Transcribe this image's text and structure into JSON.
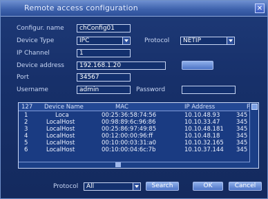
{
  "window": {
    "title": "Remote access configuration",
    "close_glyph": "✕"
  },
  "form": {
    "config_name_label": "Configur. name",
    "config_name_value": "chConfig01",
    "device_type_label": "Device Type",
    "device_type_value": "IPC",
    "protocol_label": "Protocol",
    "protocol_value": "NETIP",
    "ip_channel_label": "IP Channel",
    "ip_channel_value": "1",
    "device_address_label": "Device address",
    "device_address_value": "192.168.1.20",
    "port_label": "Port",
    "port_value": "34567",
    "username_label": "Username",
    "username_value": "admin",
    "password_label": "Password",
    "password_value": ""
  },
  "list": {
    "headers": [
      "127",
      "Device Name",
      "MAC",
      "IP Address",
      "Po"
    ],
    "rows": [
      [
        "1",
        "Loca",
        "00:25:36:58:74:56",
        "10.10.48.93",
        "345"
      ],
      [
        "2",
        "LocalHost",
        "00:98:89:6c:96:86",
        "10.10.33.47",
        "345"
      ],
      [
        "3",
        "LocalHost",
        "00:25:86:97:49:85",
        "10.10.48.181",
        "345"
      ],
      [
        "4",
        "LocalHost",
        "00:12:00:00:96:ff",
        "10.10.48.18",
        "345"
      ],
      [
        "5",
        "LocalHost",
        "00:10:00:03:31:a0",
        "10.10.32.165",
        "345"
      ],
      [
        "6",
        "LocalHost",
        "00:10:00:04:6c:7b",
        "10.10.37.144",
        "345"
      ]
    ]
  },
  "footer": {
    "protocol_label": "Protocol",
    "protocol_value": "All",
    "search_label": "Search",
    "ok_label": "OK",
    "cancel_label": "Cancel"
  }
}
